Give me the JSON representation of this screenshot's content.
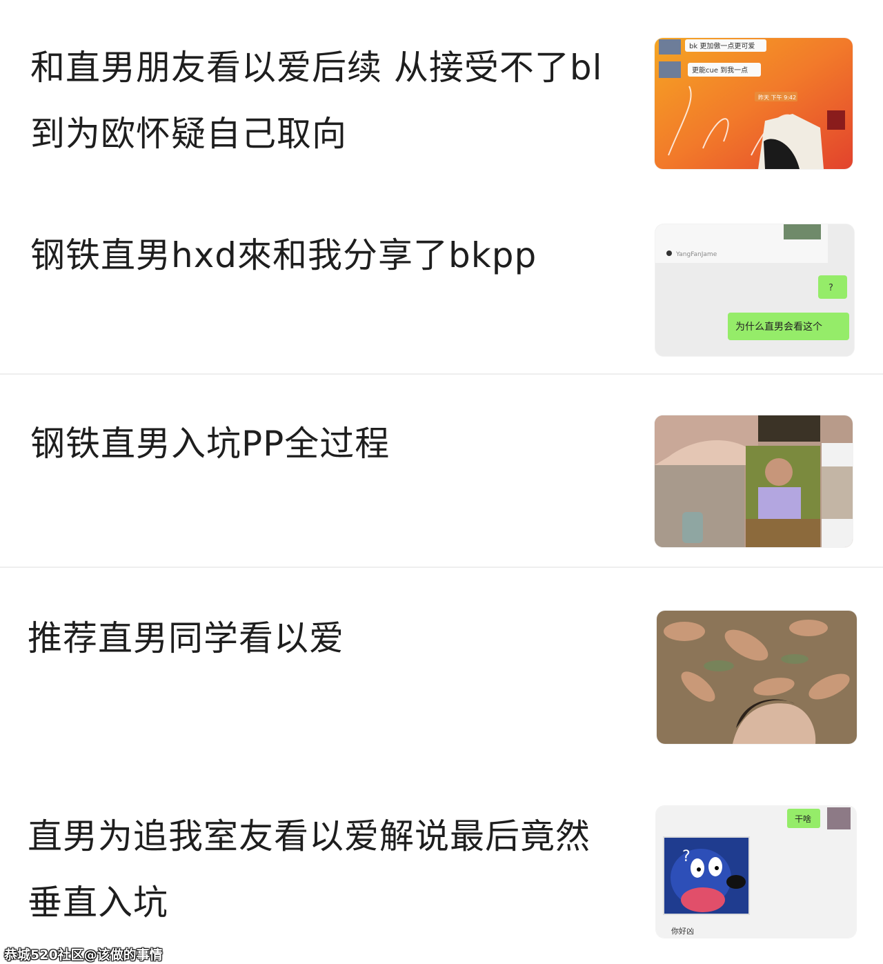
{
  "feed": {
    "items": [
      {
        "title": "和直男朋友看以爱后续 从接受不了bl到为欧怀疑自己取向",
        "thumb_texts": [
          "bk 更加傲一点更可爱",
          "更能cue 到我一点",
          "昨天 下午 9:42"
        ]
      },
      {
        "title": "钢铁直男hxd來和我分享了bkpp",
        "thumb_texts": [
          "YangFanJame",
          "?",
          "为什么直男会看这个"
        ]
      },
      {
        "title": "钢铁直男入坑PP全过程",
        "thumb_texts": []
      },
      {
        "title": "推荐直男同学看以爱",
        "thumb_texts": []
      },
      {
        "title": "直男为追我室友看以爱解说最后竟然垂直入坑",
        "thumb_texts": [
          "干啥",
          "你好凶"
        ]
      }
    ]
  },
  "watermark": "恭城520社区@该做的事情"
}
